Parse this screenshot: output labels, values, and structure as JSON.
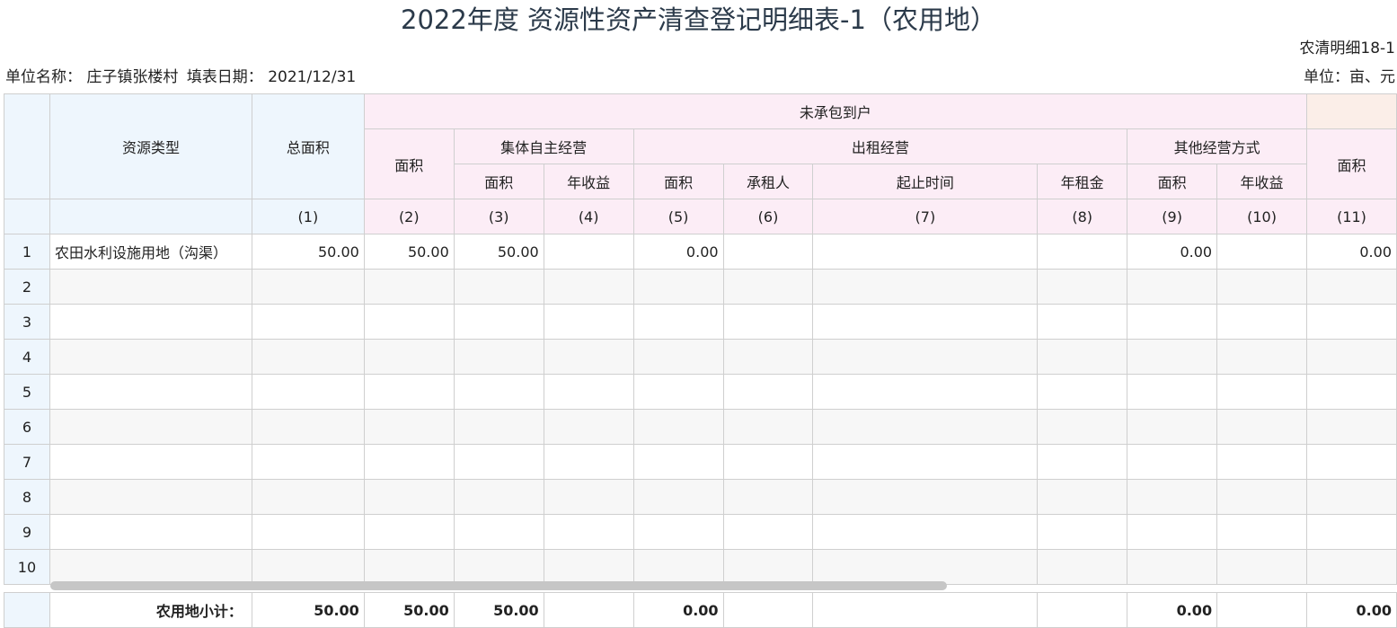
{
  "title": "2022年度 资源性资产清查登记明细表-1（农用地）",
  "form_code": "农清明细18-1",
  "unit_name_label": "单位名称：",
  "unit_name": "庄子镇张楼村",
  "fill_date_label": "填表日期：",
  "fill_date": "2021/12/31",
  "unit": "单位：亩、元",
  "headers": {
    "resource_type": "资源类型",
    "total_area": "总面积",
    "not_contracted": "未承包到户",
    "area": "面积",
    "collective_self": "集体自主经营",
    "rental": "出租经营",
    "other_mode": "其他经营方式",
    "annual_income": "年收益",
    "lessee": "承租人",
    "period": "起止时间",
    "annual_rent": "年租金",
    "col_nums": [
      "(1)",
      "(2)",
      "(3)",
      "(4)",
      "(5)",
      "(6)",
      "(7)",
      "(8)",
      "(9)",
      "(10)",
      "(11)"
    ]
  },
  "rows": [
    {
      "idx": "1",
      "type": "农田水利设施用地（沟渠）",
      "c1": "50.00",
      "c2": "50.00",
      "c3": "50.00",
      "c4": "",
      "c5": "0.00",
      "c6": "",
      "c7": "",
      "c8": "",
      "c9": "0.00",
      "c10": "",
      "c11": "0.00"
    },
    {
      "idx": "2",
      "type": "",
      "c1": "",
      "c2": "",
      "c3": "",
      "c4": "",
      "c5": "",
      "c6": "",
      "c7": "",
      "c8": "",
      "c9": "",
      "c10": "",
      "c11": ""
    },
    {
      "idx": "3",
      "type": "",
      "c1": "",
      "c2": "",
      "c3": "",
      "c4": "",
      "c5": "",
      "c6": "",
      "c7": "",
      "c8": "",
      "c9": "",
      "c10": "",
      "c11": ""
    },
    {
      "idx": "4",
      "type": "",
      "c1": "",
      "c2": "",
      "c3": "",
      "c4": "",
      "c5": "",
      "c6": "",
      "c7": "",
      "c8": "",
      "c9": "",
      "c10": "",
      "c11": ""
    },
    {
      "idx": "5",
      "type": "",
      "c1": "",
      "c2": "",
      "c3": "",
      "c4": "",
      "c5": "",
      "c6": "",
      "c7": "",
      "c8": "",
      "c9": "",
      "c10": "",
      "c11": ""
    },
    {
      "idx": "6",
      "type": "",
      "c1": "",
      "c2": "",
      "c3": "",
      "c4": "",
      "c5": "",
      "c6": "",
      "c7": "",
      "c8": "",
      "c9": "",
      "c10": "",
      "c11": ""
    },
    {
      "idx": "7",
      "type": "",
      "c1": "",
      "c2": "",
      "c3": "",
      "c4": "",
      "c5": "",
      "c6": "",
      "c7": "",
      "c8": "",
      "c9": "",
      "c10": "",
      "c11": ""
    },
    {
      "idx": "8",
      "type": "",
      "c1": "",
      "c2": "",
      "c3": "",
      "c4": "",
      "c5": "",
      "c6": "",
      "c7": "",
      "c8": "",
      "c9": "",
      "c10": "",
      "c11": ""
    },
    {
      "idx": "9",
      "type": "",
      "c1": "",
      "c2": "",
      "c3": "",
      "c4": "",
      "c5": "",
      "c6": "",
      "c7": "",
      "c8": "",
      "c9": "",
      "c10": "",
      "c11": ""
    },
    {
      "idx": "10",
      "type": "",
      "c1": "",
      "c2": "",
      "c3": "",
      "c4": "",
      "c5": "",
      "c6": "",
      "c7": "",
      "c8": "",
      "c9": "",
      "c10": "",
      "c11": ""
    }
  ],
  "total": {
    "label": "农用地小计：",
    "c1": "50.00",
    "c2": "50.00",
    "c3": "50.00",
    "c4": "",
    "c5": "0.00",
    "c6": "",
    "c7": "",
    "c8": "",
    "c9": "0.00",
    "c10": "",
    "c11": "0.00"
  },
  "colors": {
    "header_blue": "#eef6fd",
    "header_pink": "#fcedf6",
    "grid": "#cfcfcf",
    "title": "#2b3a4a"
  }
}
